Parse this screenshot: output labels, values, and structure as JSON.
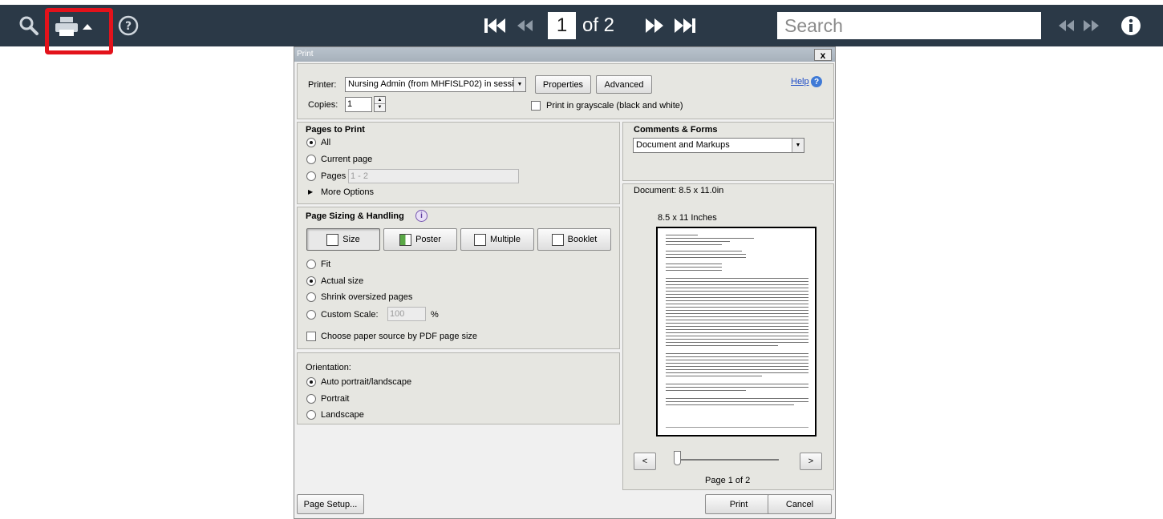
{
  "toolbar": {
    "page_current": "1",
    "page_of": "of 2",
    "search_placeholder": "Search",
    "icons": [
      "magnifier-icon",
      "printer-icon",
      "caret-up-icon",
      "help-icon",
      "first-page-icon",
      "prev-page-icon",
      "next-page-icon",
      "last-page-icon",
      "prev-result-icon",
      "next-result-icon",
      "info-icon"
    ],
    "highlight_color": "#e3121b",
    "bar_color": "#2b3947"
  },
  "dialog": {
    "title": "Print",
    "close_label": "x",
    "printer_label": "Printer:",
    "printer_value": "Nursing Admin (from MHFISLP02) in sessic",
    "properties_label": "Properties",
    "advanced_label": "Advanced",
    "help_label": "Help",
    "copies_label": "Copies:",
    "copies_value": "1",
    "grayscale_label": "Print in grayscale (black and white)",
    "pages_section": {
      "title": "Pages to Print",
      "all": "All",
      "current_page": "Current page",
      "pages": "Pages",
      "pages_range": "1 - 2",
      "more_options": "More Options"
    },
    "sizing_section": {
      "title": "Page Sizing & Handling",
      "modes": [
        "Size",
        "Poster",
        "Multiple",
        "Booklet"
      ],
      "fit": "Fit",
      "actual_size": "Actual size",
      "shrink": "Shrink oversized pages",
      "custom_scale": "Custom Scale:",
      "custom_scale_value": "100",
      "percent": "%",
      "paper_source": "Choose paper source by PDF page size"
    },
    "orientation_section": {
      "title": "Orientation:",
      "auto": "Auto portrait/landscape",
      "portrait": "Portrait",
      "landscape": "Landscape"
    },
    "comments_section": {
      "title": "Comments & Forms",
      "value": "Document and Markups"
    },
    "document_label": "Document: 8.5 x 11.0in",
    "preview_label": "8.5 x 11 Inches",
    "prev_btn": "<",
    "next_btn": ">",
    "page_indicator": "Page 1 of 2",
    "page_setup": "Page Setup...",
    "print": "Print",
    "cancel": "Cancel"
  }
}
